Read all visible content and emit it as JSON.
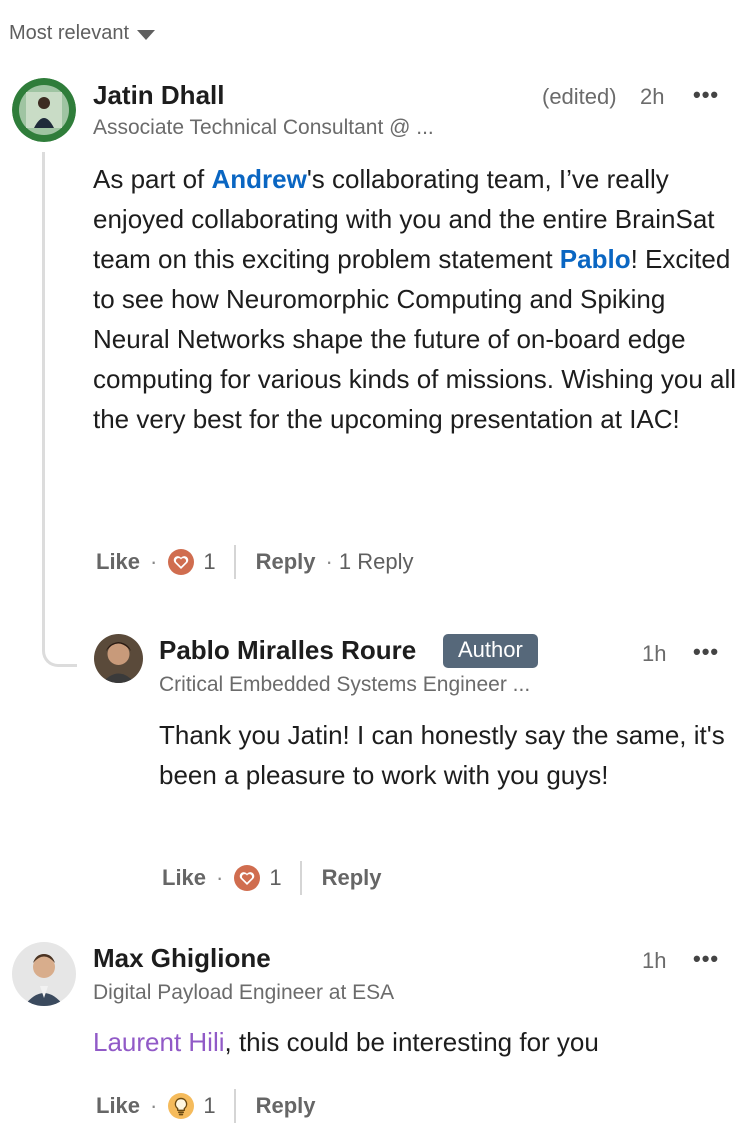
{
  "sort": {
    "label": "Most relevant"
  },
  "comments": [
    {
      "author": "Jatin Dhall",
      "headline": "Associate Technical Consultant @ ...",
      "edited": "(edited)",
      "time": "2h",
      "body": {
        "p1": "As part of ",
        "m1": "Andrew",
        "p2": "'s collaborating team, I’ve really enjoyed collaborating with you and the entire BrainSat team on this exciting problem statement ",
        "m2": "Pablo",
        "p3": "! Excited to see how Neuromorphic Computing and Spiking Neural Networks shape the future of on-board edge computing for various kinds of missions. Wishing you all the very best for the upcoming presentation at IAC!"
      },
      "like_label": "Like",
      "reaction_count": "1",
      "reply_label": "Reply",
      "replies_label": "1 Reply",
      "reaction_icon": "heart-icon",
      "reaction_color": "#d06d4f"
    },
    {
      "author": "Pablo Miralles Roure",
      "badge": "Author",
      "headline": "Critical Embedded Systems Engineer ...",
      "time": "1h",
      "body": "Thank you Jatin! I can honestly say the same, it's been a pleasure to work with you guys!",
      "like_label": "Like",
      "reaction_count": "1",
      "reply_label": "Reply",
      "reaction_icon": "heart-icon",
      "reaction_color": "#d06d4f"
    },
    {
      "author": "Max Ghiglione",
      "headline": "Digital Payload Engineer at ESA",
      "time": "1h",
      "body": {
        "m1": "Laurent Hili",
        "p1": ", this could be interesting for you"
      },
      "like_label": "Like",
      "reaction_count": "1",
      "reply_label": "Reply",
      "reaction_icon": "lightbulb-icon",
      "reaction_color": "#f5bb5c"
    }
  ]
}
